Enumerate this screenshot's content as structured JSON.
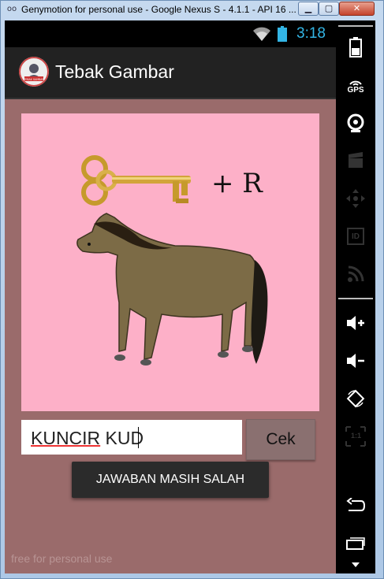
{
  "window": {
    "title": "Genymotion for personal use - Google Nexus S - 4.1.1 - API 16 ...",
    "icon": "genymotion-icon",
    "minimize_label": "▁",
    "maximize_label": "▢",
    "close_label": "✕"
  },
  "status_bar": {
    "time": "3:18",
    "icons": [
      "wifi-icon",
      "battery-icon"
    ],
    "accent_color": "#33b5e5"
  },
  "action_bar": {
    "logo_text": "TEBAK GAMBAR",
    "title": "Tebak Gambar"
  },
  "puzzle": {
    "plus_text": "+ R",
    "images": [
      "key-image",
      "horse-image"
    ],
    "background_color": "#fdb0c8"
  },
  "answer": {
    "value_underlined": "KUNCIR",
    "value_rest": " KUD",
    "check_label": "Cek"
  },
  "toast": {
    "message": "JAWABAN MASIH SALAH"
  },
  "watermark": "free for personal use",
  "sidebar": {
    "gps_label": "GPS",
    "id_label": "ID",
    "scale_label": "1:1",
    "icons": [
      "battery-icon",
      "gps-icon",
      "camera-icon",
      "video-icon",
      "dpad-icon",
      "id-icon",
      "rss-icon",
      "volume-up-icon",
      "volume-down-icon",
      "rotate-icon",
      "scale-icon",
      "back-icon",
      "recent-apps-icon",
      "menu-icon"
    ]
  },
  "colors": {
    "screen_background": "#9a6b6b",
    "action_bar": "#222222",
    "button": "#8a7070"
  }
}
